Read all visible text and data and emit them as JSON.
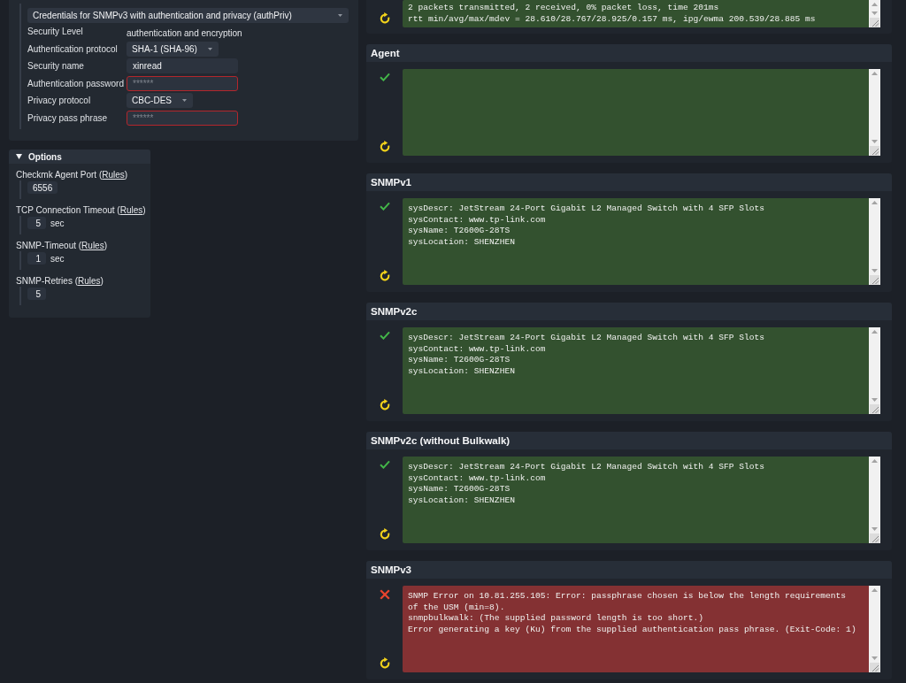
{
  "credentials_panel": {
    "mode_select": "Credentials for SNMPv3 with authentication and privacy (authPriv)",
    "rows": [
      {
        "kind": "text",
        "label": "Security Level",
        "value": "authentication and encryption"
      },
      {
        "kind": "select",
        "label": "Authentication protocol",
        "value": "SHA-1 (SHA-96)"
      },
      {
        "kind": "input",
        "label": "Security name",
        "value": "xinread",
        "invalid": false
      },
      {
        "kind": "input",
        "label": "Authentication password",
        "placeholder": "******",
        "invalid": true
      },
      {
        "kind": "select",
        "label": "Privacy protocol",
        "value": "CBC-DES"
      },
      {
        "kind": "input",
        "label": "Privacy pass phrase",
        "placeholder": "******",
        "invalid": true
      }
    ]
  },
  "options_panel": {
    "title": "Options",
    "expanded": true,
    "fields": [
      {
        "label": "Checkmk Agent Port (",
        "link": "Rules",
        "label_end": ")",
        "value": "6556"
      },
      {
        "label": "TCP Connection Timeout (",
        "link": "Rules",
        "label_end": ")",
        "value": "5",
        "unit": "sec"
      },
      {
        "label": "SNMP-Timeout (",
        "link": "Rules",
        "label_end": ")",
        "value": "1",
        "unit": "sec"
      },
      {
        "label": "SNMP-Retries (",
        "link": "Rules",
        "label_end": ")",
        "value": "5"
      }
    ]
  },
  "test_results": [
    {
      "failed": false,
      "status_icon_shown": false,
      "output": [
        "2 packets transmitted, 2 received, 0% packet loss, time 201ms",
        "rtt min/avg/max/mdev = 28.610/28.767/28.925/0.157 ms, ipg/ewma 200.539/28.885 ms"
      ]
    },
    {
      "title": "Agent",
      "failed": false,
      "status_icon_shown": true
    },
    {
      "title": "SNMPv1",
      "failed": false,
      "status_icon_shown": true,
      "output": [
        "sysDescr: JetStream 24-Port Gigabit L2 Managed Switch with 4 SFP Slots",
        "sysContact: www.tp-link.com",
        "sysName: T2600G-28TS",
        "sysLocation: SHENZHEN"
      ]
    },
    {
      "title": "SNMPv2c",
      "failed": false,
      "status_icon_shown": true,
      "output": [
        "sysDescr: JetStream 24-Port Gigabit L2 Managed Switch with 4 SFP Slots",
        "sysContact: www.tp-link.com",
        "sysName: T2600G-28TS",
        "sysLocation: SHENZHEN"
      ]
    },
    {
      "title": "SNMPv2c (without Bulkwalk)",
      "failed": false,
      "status_icon_shown": true,
      "output": [
        "sysDescr: JetStream 24-Port Gigabit L2 Managed Switch with 4 SFP Slots",
        "sysContact: www.tp-link.com",
        "sysName: T2600G-28TS",
        "sysLocation: SHENZHEN"
      ]
    },
    {
      "title": "SNMPv3",
      "failed": true,
      "status_icon_shown": true,
      "output": [
        "SNMP Error on 10.81.255.105: Error: passphrase chosen is below the length requirements",
        "of the USM (min=8).",
        "snmpbulkwalk: (The supplied password length is too short.)",
        "Error generating a key (Ku) from the supplied authentication pass phrase. (Exit-Code: 1)"
      ]
    }
  ]
}
